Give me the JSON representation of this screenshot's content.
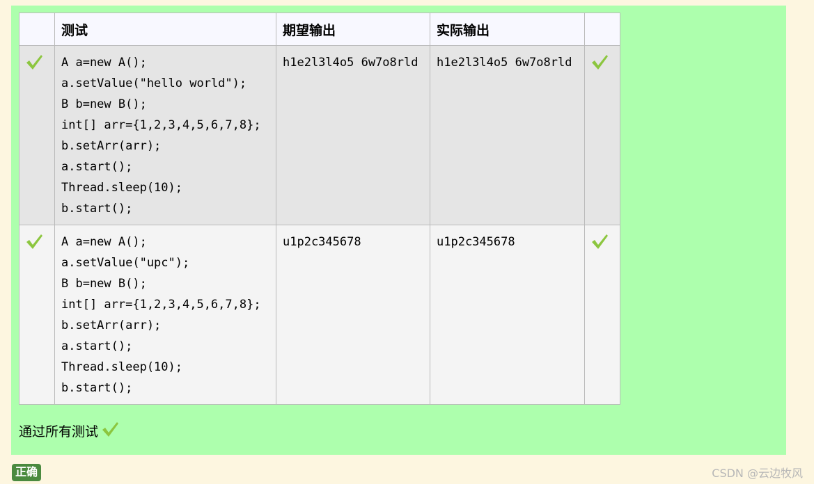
{
  "table": {
    "headers": [
      "",
      "测试",
      "期望输出",
      "实际输出",
      ""
    ],
    "rows": [
      {
        "status_icon": "check-icon",
        "test_lines": [
          "A a=new A();",
          "a.setValue(\"hello world\");",
          "B b=new B();",
          "int[] arr={1,2,3,4,5,6,7,8};",
          "b.setArr(arr);",
          "a.start();",
          "Thread.sleep(10);",
          "b.start();"
        ],
        "expected": "h1e2l3l4o5 6w7o8rld",
        "actual": "h1e2l3l4o5 6w7o8rld"
      },
      {
        "status_icon": "check-icon",
        "test_lines": [
          "A a=new A();",
          "a.setValue(\"upc\");",
          "B b=new B();",
          "int[] arr={1,2,3,4,5,6,7,8};",
          "b.setArr(arr);",
          "a.start();",
          "Thread.sleep(10);",
          "b.start();"
        ],
        "expected": "u1p2c345678",
        "actual": "u1p2c345678"
      }
    ]
  },
  "summary": "通过所有测试",
  "badge": "正确",
  "watermark": "CSDN @云边牧风",
  "colors": {
    "page_bg": "#fdf6e0",
    "panel_bg": "#adffad",
    "check": "#8cc63f",
    "badge_bg": "#4a8a3f"
  }
}
